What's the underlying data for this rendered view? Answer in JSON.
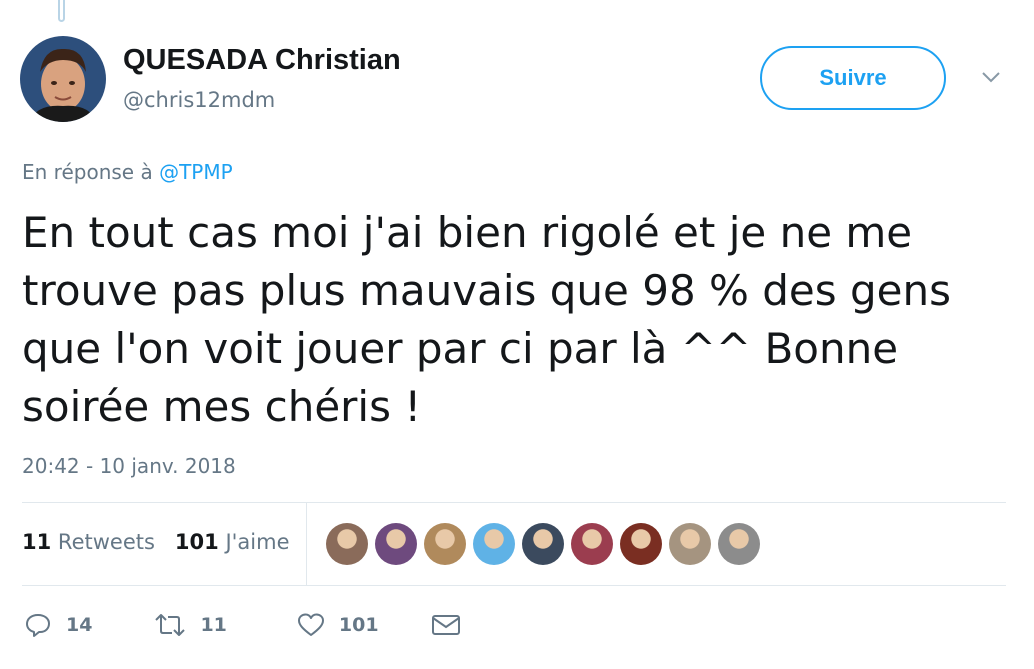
{
  "author": {
    "name": "QUESADA Christian",
    "handle": "@chris12mdm"
  },
  "follow_label": "Suivre",
  "reply": {
    "prefix": "En réponse à",
    "mention": "@TPMP"
  },
  "tweet": {
    "text": "En tout cas moi j'ai bien rigolé et je ne me\ntrouve pas plus mauvais que 98 % des gens\nque l'on voit jouer par ci par là ^^ Bonne\nsoirée mes chéris !",
    "timestamp": "20:42 - 10 janv. 2018"
  },
  "stats": {
    "retweets_count": "11",
    "retweets_label": "Retweets",
    "likes_count": "101",
    "likes_label": "J'aime"
  },
  "likers": [
    {
      "icon": "liker-avatar",
      "color": "#8a6b5a"
    },
    {
      "icon": "liker-avatar",
      "color": "#6e4a7e"
    },
    {
      "icon": "liker-avatar",
      "color": "#b08a5c"
    },
    {
      "icon": "liker-avatar",
      "color": "#5fb2e6"
    },
    {
      "icon": "liker-avatar",
      "color": "#3b4a5e"
    },
    {
      "icon": "liker-avatar",
      "color": "#9b3d4f"
    },
    {
      "icon": "liker-avatar",
      "color": "#7a2e22"
    },
    {
      "icon": "liker-avatar",
      "color": "#a59480"
    },
    {
      "icon": "liker-avatar",
      "color": "#8c8c8c"
    }
  ],
  "actions": {
    "reply_count": "14",
    "retweet_count": "11",
    "like_count": "101"
  },
  "colors": {
    "accent": "#1da1f2",
    "secondary_text": "#657786",
    "divider": "#e1e8ed"
  }
}
